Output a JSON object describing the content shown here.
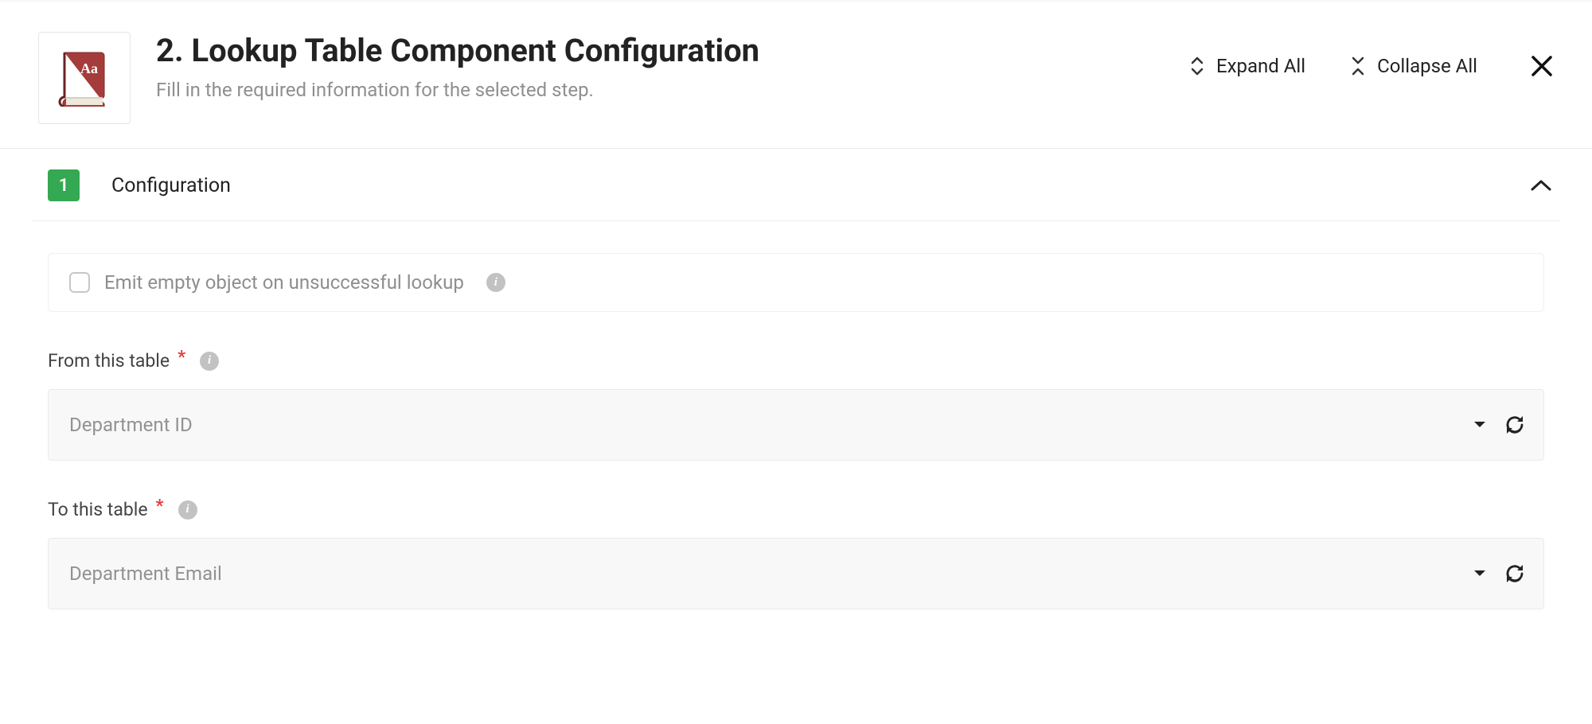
{
  "header": {
    "title": "2. Lookup Table Component Configuration",
    "subtitle": "Fill in the required information for the selected step.",
    "expand_all": "Expand All",
    "collapse_all": "Collapse All",
    "icon_text": "Aa"
  },
  "section": {
    "step_number": "1",
    "title": "Configuration"
  },
  "fields": {
    "emit_empty_label": "Emit empty object on unsuccessful lookup",
    "from_table": {
      "label": "From this table",
      "value": "Department ID"
    },
    "to_table": {
      "label": "To this table",
      "value": "Department Email"
    }
  },
  "glyphs": {
    "info": "i",
    "required": "*"
  }
}
